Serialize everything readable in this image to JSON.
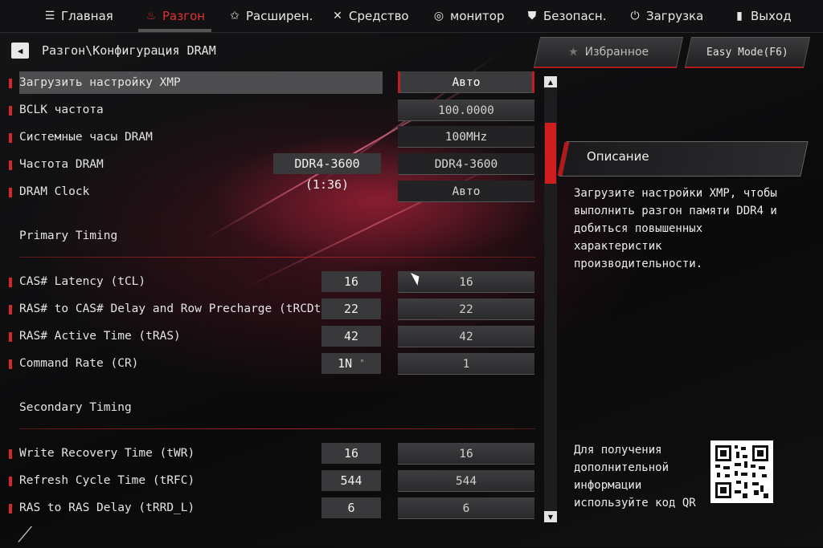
{
  "nav": {
    "tabs": [
      {
        "label": "Главная",
        "icon": "list-icon"
      },
      {
        "label": "Разгон",
        "icon": "flame-icon"
      },
      {
        "label": "Расширен.",
        "icon": "star-icon"
      },
      {
        "label": "Средство",
        "icon": "tools-icon"
      },
      {
        "label": "монитор",
        "icon": "gauge-icon"
      },
      {
        "label": "Безопасн.",
        "icon": "shield-icon"
      },
      {
        "label": "Загрузка",
        "icon": "power-icon"
      },
      {
        "label": "Выход",
        "icon": "exit-icon"
      }
    ],
    "active_index": 1
  },
  "breadcrumb": "Разгон\\Конфигурация DRAM",
  "header": {
    "favorites_label": "Избранное",
    "easy_mode_label": "Easy Mode(F6)"
  },
  "settings": {
    "dram_config": [
      {
        "label": "Загрузить настройку XMP",
        "value": "Авто"
      },
      {
        "label": "BCLK частота",
        "value": "100.0000"
      },
      {
        "label": "Системные часы DRAM",
        "value": "100MHz"
      },
      {
        "label": "Частота DRAM",
        "current": "DDR4-3600 (1:36)",
        "value": "DDR4-3600"
      },
      {
        "label": "DRAM Clock",
        "value": "Авто"
      }
    ],
    "primary_title": "Primary Timing",
    "primary": [
      {
        "label": "CAS# Latency (tCL)",
        "current": "16",
        "value": "16"
      },
      {
        "label": "RAS# to CAS# Delay and Row Precharge (tRCDtRP)",
        "current": "22",
        "value": "22"
      },
      {
        "label": "RAS# Active Time (tRAS)",
        "current": "42",
        "value": "42"
      },
      {
        "label": "Command Rate (CR)",
        "current": "1N",
        "value": "1"
      }
    ],
    "secondary_title": "Secondary Timing",
    "secondary": [
      {
        "label": "Write Recovery Time (tWR)",
        "current": "16",
        "value": "16"
      },
      {
        "label": "Refresh Cycle Time (tRFC)",
        "current": "544",
        "value": "544"
      },
      {
        "label": "RAS to RAS Delay (tRRD_L)",
        "current": "6",
        "value": "6"
      }
    ]
  },
  "description": {
    "title": "Описание",
    "text": "Загрузите настройки XMP, чтобы выполнить разгон памяти DDR4 и добиться повышенных характеристик производительности."
  },
  "qr": {
    "text": "Для получения дополнительной информации используйте код QR"
  },
  "colors": {
    "accent": "#d52828",
    "background": "#0b0b0d",
    "value_box": "#3a3a3d"
  }
}
